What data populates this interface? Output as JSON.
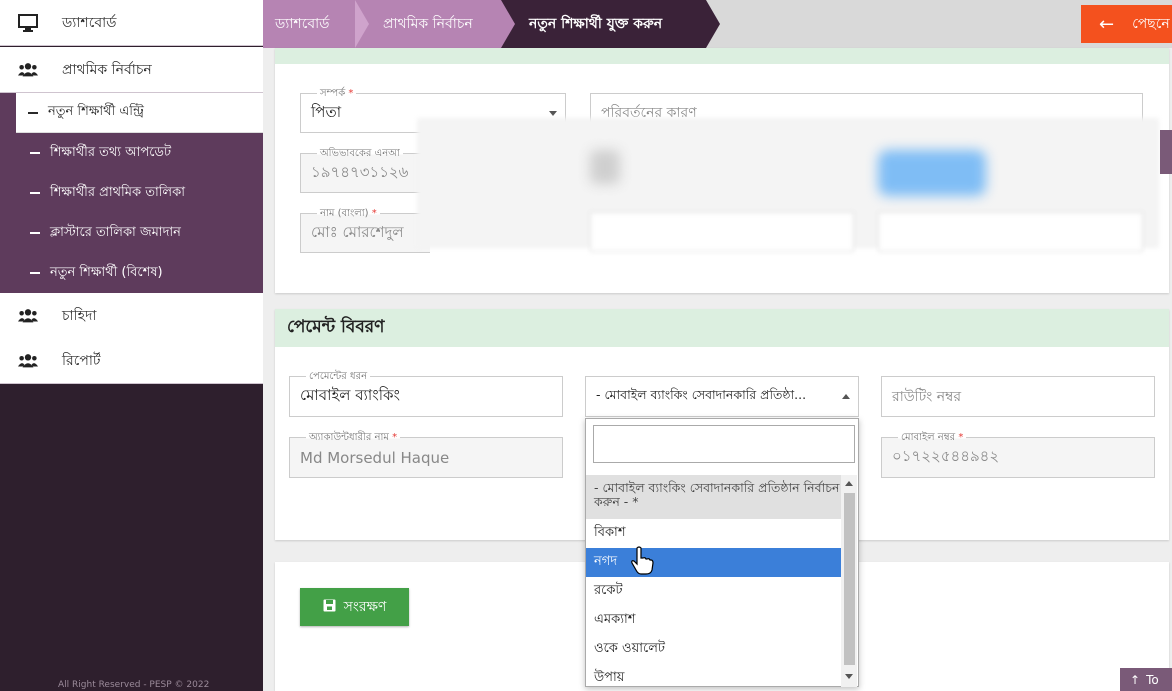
{
  "sidebar": {
    "dashboard": "ড্যাশবোর্ড",
    "primary_selection": "প্রাথমিক নির্বাচন",
    "submenu": [
      "নতুন শিক্ষার্থী এন্ট্রি",
      "শিক্ষার্থীর তথ্য আপডেট",
      "শিক্ষার্থীর প্রাথমিক তালিকা",
      "ক্লাস্টারে তালিকা জমাদান",
      "নতুন শিক্ষার্থী (বিশেষ)"
    ],
    "demand": "চাহিদা",
    "report": "রিপোর্ট",
    "copyright": "All Right Reserved - PESP © 2022"
  },
  "breadcrumb": {
    "items": [
      "ড্যাশবোর্ড",
      "প্রাথমিক নির্বাচন",
      "নতুন শিক্ষার্থী যুক্ত করুন"
    ],
    "back_label": "পেছনে"
  },
  "guardian": {
    "relation_label": "সম্পর্ক",
    "relation_value": "পিতা",
    "change_reason_placeholder": "পরিবর্তনের কারণ",
    "nid_label": "অভিভাবকের এনআ",
    "nid_value": "১৯৭৪৭৩১১২৬",
    "name_label": "নাম (বাংলা)",
    "name_value": "মোঃ মোরশেদুল"
  },
  "payment": {
    "section_title": "পেমেন্ট বিবরণ",
    "type_label": "পেমেন্টের ধরন",
    "type_value": "মোবাইল ব্যাংকিং",
    "provider_value": "- মোবাইল ব্যাংকিং সেবাদানকারি প্রতিষ্ঠা...",
    "routing_placeholder": "রাউটিং নম্বর",
    "account_holder_label": "অ্যাকাউন্টধারীর নাম",
    "account_holder_value": "Md Morsedul Haque",
    "mobile_label": "মোবাইল নম্বর",
    "mobile_value": "০১৭২২৫৪৪৯৪২",
    "required_mark": "*"
  },
  "dropdown": {
    "options": [
      "- মোবাইল ব্যাংকিং সেবাদানকারি প্রতিষ্ঠান নির্বাচন করুন - *",
      "বিকাশ",
      "নগদ",
      "রকেট",
      "এমক্যাশ",
      "ওকে ওয়ালেট",
      "উপায়"
    ],
    "highlighted_index": 2
  },
  "save_label": "সংরক্ষণ",
  "to_top_label": "To",
  "colors": {
    "sidebar_bg": "#2e1f2d",
    "submenu_bg": "#5e3b5c",
    "crumb_light": "#b684b3",
    "crumb_dark": "#3a2238",
    "back_button": "#f4511e",
    "save_button": "#43a047",
    "section_header": "#dcefe0",
    "highlight": "#3b7fd9"
  }
}
